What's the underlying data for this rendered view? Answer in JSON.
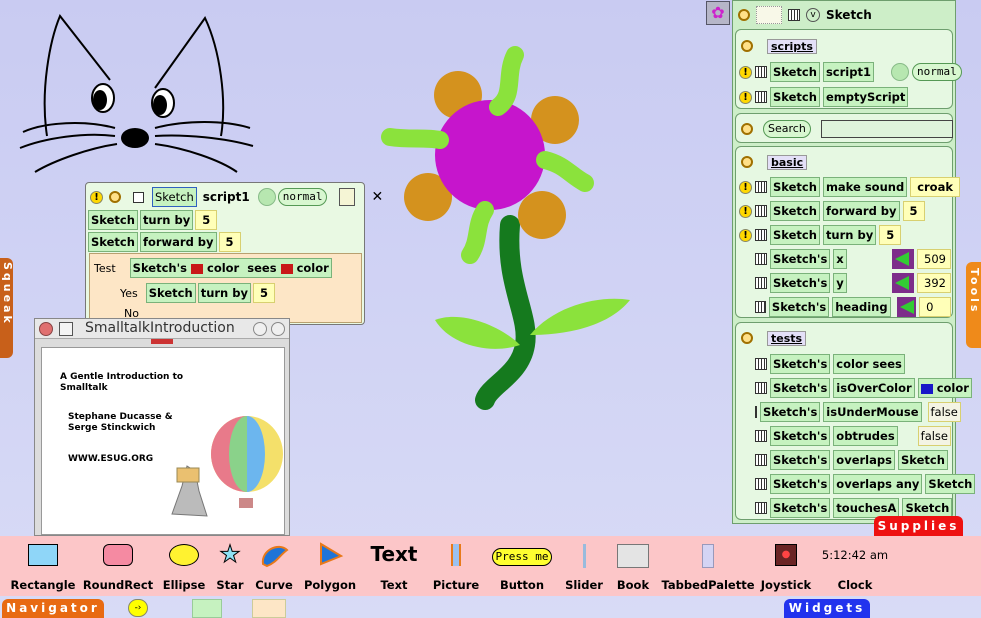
{
  "flower_window": {
    "tile": "Sketch",
    "script": "script1",
    "mode": "normal",
    "lines": [
      {
        "obj": "Sketch",
        "cmd": "turn by",
        "val": "5"
      },
      {
        "obj": "Sketch",
        "cmd": "forward by",
        "val": "5"
      }
    ],
    "test": {
      "label": "Test",
      "subject": "Sketch's",
      "color_word": "color",
      "sees": "sees",
      "color_word2": "color",
      "yes": "Yes",
      "yes_obj": "Sketch",
      "yes_cmd": "turn by",
      "yes_val": "5",
      "no": "No"
    }
  },
  "book": {
    "title": "SmalltalkIntroduction",
    "heading": "A Gentle Introduction to Smalltalk",
    "authors": "Stephane Ducasse & Serge Stinckwich",
    "url": "WWW.ESUG.ORG"
  },
  "viewer": {
    "title": "Sketch",
    "scripts": {
      "title": "scripts",
      "items": [
        {
          "obj": "Sketch",
          "cmd": "script1",
          "mode": "normal"
        },
        {
          "obj": "Sketch",
          "cmd": "emptyScript"
        }
      ]
    },
    "search": {
      "label": "Search",
      "value": ""
    },
    "basic": {
      "title": "basic",
      "commands": [
        {
          "obj": "Sketch",
          "cmd": "make sound",
          "val": "croak"
        },
        {
          "obj": "Sketch",
          "cmd": "forward by",
          "val": "5"
        },
        {
          "obj": "Sketch",
          "cmd": "turn by",
          "val": "5"
        }
      ],
      "props": [
        {
          "obj": "Sketch's",
          "prop": "x",
          "val": "509"
        },
        {
          "obj": "Sketch's",
          "prop": "y",
          "val": "392"
        },
        {
          "obj": "Sketch's",
          "prop": "heading",
          "val": "0"
        }
      ]
    },
    "tests": {
      "title": "tests",
      "rows": [
        {
          "obj": "Sketch's",
          "a": "color",
          "b": "sees",
          "c": ""
        },
        {
          "obj": "Sketch's",
          "a": "isOverColor",
          "b": "color",
          "c": ""
        },
        {
          "obj": "Sketch's",
          "a": "isUnderMouse",
          "b": "",
          "c": "false"
        },
        {
          "obj": "Sketch's",
          "a": "obtrudes",
          "b": "",
          "c": "false"
        },
        {
          "obj": "Sketch's",
          "a": "overlaps",
          "b": "Sketch",
          "c": ""
        },
        {
          "obj": "Sketch's",
          "a": "overlaps any",
          "b": "Sketch",
          "c": ""
        },
        {
          "obj": "Sketch's",
          "a": "touchesA",
          "b": "Sketch",
          "c": ""
        }
      ]
    }
  },
  "flaps": {
    "squeak": "Squeak",
    "tools": "Tools",
    "supplies": "Supplies",
    "navigator": "Navigator",
    "widgets": "Widgets"
  },
  "supplies": {
    "items": [
      "Rectangle",
      "RoundRect",
      "Ellipse",
      "Star",
      "Curve",
      "Polygon",
      "Text",
      "Picture",
      "Button",
      "Slider",
      "Book",
      "TabbedPalette",
      "Joystick",
      "Clock"
    ],
    "text_glyph": "Text",
    "button_glyph": "Press me",
    "clock_time": "5:12:42 am"
  },
  "colors": {
    "green_tile": "#c6f2c0",
    "supplies_bar": "#fcc6c8",
    "flap_orange": "#e86a12",
    "flap_blue": "#2233ee",
    "flap_red": "#ee1111"
  }
}
